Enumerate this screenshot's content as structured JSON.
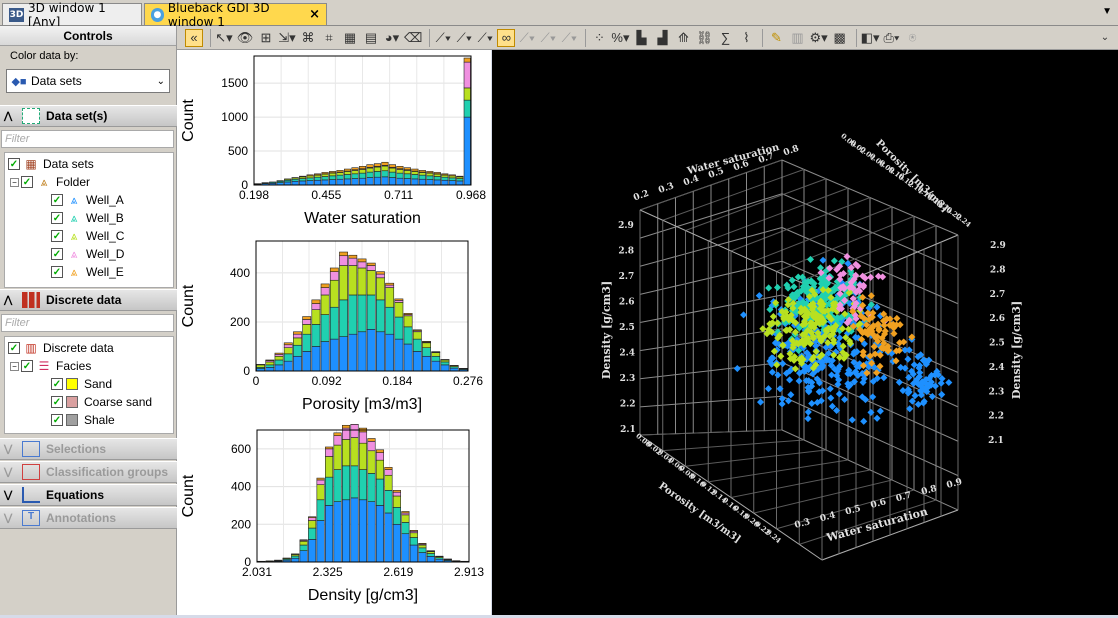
{
  "tabs": [
    {
      "label": "3D window 1 [Any]",
      "icon": "3d-icon"
    },
    {
      "label": "Blueback GDI 3D window 1",
      "icon": "blueback-icon"
    }
  ],
  "controls": {
    "title": "Controls",
    "color_by_label": "Color data by:",
    "color_by_value": "Data sets",
    "filter_placeholder": "Filter",
    "datasets_section": "Data set(s)",
    "discrete_section": "Discrete data",
    "datasets_tree": {
      "root": "Data sets",
      "folder": "Folder",
      "wells": [
        {
          "label": "Well_A",
          "color": "#1e90ff"
        },
        {
          "label": "Well_B",
          "color": "#20d0b0"
        },
        {
          "label": "Well_C",
          "color": "#b8e020"
        },
        {
          "label": "Well_D",
          "color": "#f090e0"
        },
        {
          "label": "Well_E",
          "color": "#f0a020"
        }
      ]
    },
    "discrete_tree": {
      "root": "Discrete data",
      "facies": "Facies",
      "items": [
        {
          "label": "Sand",
          "color": "#ffff00"
        },
        {
          "label": "Coarse sand",
          "color": "#d9a0a0"
        },
        {
          "label": "Shale",
          "color": "#a0a0a0"
        }
      ]
    },
    "collapsed_sections": [
      {
        "label": "Selections",
        "enabled": false
      },
      {
        "label": "Classification groups",
        "enabled": false
      },
      {
        "label": "Equations",
        "enabled": true
      },
      {
        "label": "Annotations",
        "enabled": false
      }
    ]
  },
  "histograms": [
    {
      "xlabel": "Water saturation",
      "ylabel": "Count",
      "xticks": [
        "0.198",
        "0.455",
        "0.711",
        "0.968"
      ],
      "yticks": [
        "0",
        "500",
        "1000",
        "1500"
      ],
      "ymax": 1900,
      "bins": [
        [
          10,
          5,
          5,
          0,
          0
        ],
        [
          20,
          10,
          5,
          0,
          0
        ],
        [
          25,
          15,
          5,
          0,
          0
        ],
        [
          35,
          20,
          10,
          0,
          0
        ],
        [
          45,
          25,
          15,
          0,
          5
        ],
        [
          55,
          30,
          20,
          0,
          5
        ],
        [
          60,
          35,
          25,
          0,
          10
        ],
        [
          65,
          40,
          30,
          0,
          15
        ],
        [
          70,
          45,
          30,
          5,
          15
        ],
        [
          75,
          50,
          35,
          5,
          20
        ],
        [
          80,
          55,
          40,
          5,
          20
        ],
        [
          85,
          60,
          40,
          5,
          25
        ],
        [
          90,
          65,
          45,
          5,
          30
        ],
        [
          95,
          70,
          50,
          10,
          30
        ],
        [
          100,
          75,
          55,
          10,
          35
        ],
        [
          110,
          80,
          60,
          10,
          40
        ],
        [
          115,
          85,
          65,
          10,
          40
        ],
        [
          120,
          90,
          70,
          10,
          45
        ],
        [
          110,
          80,
          60,
          10,
          40
        ],
        [
          100,
          75,
          55,
          10,
          35
        ],
        [
          95,
          70,
          50,
          10,
          30
        ],
        [
          90,
          65,
          45,
          5,
          30
        ],
        [
          85,
          60,
          40,
          5,
          25
        ],
        [
          80,
          55,
          40,
          5,
          20
        ],
        [
          75,
          50,
          35,
          5,
          20
        ],
        [
          70,
          45,
          30,
          5,
          15
        ],
        [
          65,
          40,
          30,
          0,
          15
        ],
        [
          60,
          35,
          25,
          0,
          10
        ],
        [
          1000,
          250,
          180,
          380,
          60
        ]
      ]
    },
    {
      "xlabel": "Porosity [m3/m3]",
      "ylabel": "Count",
      "xticks": [
        "0",
        "0.092",
        "0.184",
        "0.276"
      ],
      "yticks": [
        "0",
        "200",
        "400"
      ],
      "ymax": 530,
      "bins": [
        [
          10,
          5,
          10,
          0,
          2
        ],
        [
          15,
          10,
          12,
          5,
          3
        ],
        [
          25,
          20,
          15,
          8,
          5
        ],
        [
          40,
          30,
          25,
          12,
          8
        ],
        [
          60,
          45,
          30,
          15,
          10
        ],
        [
          80,
          70,
          40,
          20,
          12
        ],
        [
          100,
          90,
          60,
          25,
          15
        ],
        [
          120,
          110,
          80,
          30,
          15
        ],
        [
          130,
          130,
          110,
          35,
          15
        ],
        [
          140,
          150,
          140,
          40,
          15
        ],
        [
          150,
          160,
          120,
          30,
          12
        ],
        [
          160,
          150,
          110,
          25,
          12
        ],
        [
          170,
          140,
          100,
          20,
          10
        ],
        [
          160,
          130,
          90,
          15,
          10
        ],
        [
          150,
          110,
          80,
          10,
          8
        ],
        [
          130,
          90,
          60,
          8,
          6
        ],
        [
          110,
          70,
          45,
          5,
          5
        ],
        [
          80,
          50,
          30,
          4,
          4
        ],
        [
          60,
          35,
          20,
          3,
          3
        ],
        [
          40,
          20,
          15,
          2,
          2
        ],
        [
          25,
          12,
          8,
          1,
          1
        ],
        [
          12,
          6,
          4,
          0,
          1
        ],
        [
          6,
          3,
          2,
          0,
          0
        ]
      ]
    },
    {
      "xlabel": "Density [g/cm3]",
      "ylabel": "Count",
      "xticks": [
        "2.031",
        "2.325",
        "2.619",
        "2.913"
      ],
      "yticks": [
        "0",
        "200",
        "400",
        "600"
      ],
      "ymax": 700,
      "bins": [
        [
          2,
          1,
          1,
          0,
          0
        ],
        [
          3,
          2,
          1,
          0,
          0
        ],
        [
          5,
          3,
          2,
          0,
          0
        ],
        [
          10,
          6,
          4,
          1,
          0
        ],
        [
          20,
          12,
          8,
          2,
          1
        ],
        [
          60,
          30,
          20,
          5,
          3
        ],
        [
          120,
          60,
          40,
          15,
          5
        ],
        [
          220,
          110,
          80,
          25,
          10
        ],
        [
          300,
          150,
          110,
          40,
          10
        ],
        [
          320,
          170,
          130,
          50,
          15
        ],
        [
          330,
          180,
          140,
          60,
          15
        ],
        [
          340,
          170,
          150,
          70,
          20
        ],
        [
          330,
          160,
          140,
          60,
          20
        ],
        [
          320,
          150,
          120,
          50,
          15
        ],
        [
          300,
          140,
          100,
          40,
          15
        ],
        [
          260,
          120,
          80,
          30,
          12
        ],
        [
          200,
          90,
          60,
          20,
          10
        ],
        [
          150,
          60,
          40,
          10,
          8
        ],
        [
          90,
          40,
          25,
          8,
          5
        ],
        [
          50,
          25,
          15,
          5,
          4
        ],
        [
          30,
          15,
          10,
          3,
          2
        ],
        [
          15,
          8,
          5,
          2,
          1
        ],
        [
          8,
          4,
          3,
          1,
          0
        ],
        [
          4,
          2,
          1,
          0,
          0
        ],
        [
          2,
          1,
          1,
          0,
          0
        ]
      ]
    }
  ],
  "view3d": {
    "axis_labels": {
      "ws_top": "Water saturation",
      "por_top": "Porosity [m3/m3]",
      "den_left": "Density [g/cm3]",
      "den_right": "Density [g/cm3]",
      "por_bottom": "Porosity [m3/m3]",
      "ws_bottom": "Water saturation"
    },
    "ws_ticks": [
      "0.2",
      "0.3",
      "0.4",
      "0.5",
      "0.6",
      "0.7",
      "0.8"
    ],
    "ws_bottom_ticks": [
      "0.3",
      "0.4",
      "0.5",
      "0.6",
      "0.7",
      "0.8",
      "0.9"
    ],
    "den_ticks": [
      "2.9",
      "2.8",
      "2.7",
      "2.6",
      "2.5",
      "2.4",
      "2.3",
      "2.2",
      "2.1"
    ],
    "den_right_ticks": [
      "2.9",
      "2.8",
      "2.7",
      "2.6",
      "2.5",
      "2.4",
      "2.3",
      "2.2",
      "2.1"
    ],
    "por_ticks": [
      "0.00",
      "0.02",
      "0.04",
      "0.06",
      "0.08",
      "0.10",
      "0.12",
      "0.14",
      "0.16",
      "0.18",
      "0.20",
      "0.22",
      "0.24"
    ],
    "por_top_ticks": [
      "0.00",
      "0.02",
      "0.04",
      "0.06",
      "0.08",
      "0.10",
      "0.12",
      "0.14",
      "0.16",
      "0.18",
      "0.20",
      "0.22",
      "0.24"
    ]
  }
}
